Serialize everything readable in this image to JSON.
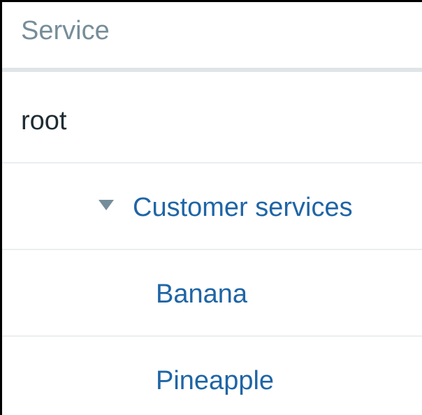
{
  "table": {
    "header": {
      "service_label": "Service"
    },
    "rows": [
      {
        "name": "root",
        "type": "plain",
        "depth": 0
      },
      {
        "name": "Customer services",
        "type": "link",
        "depth": 1,
        "expanded": true,
        "toggle_icon": "triangle-down-icon"
      },
      {
        "name": "Banana",
        "type": "link",
        "depth": 2
      },
      {
        "name": "Pineapple",
        "type": "link",
        "depth": 2
      }
    ]
  },
  "colors": {
    "link": "#1f65a6",
    "header_text": "#768d99",
    "text": "#1f2c33",
    "divider": "#ebeef0",
    "header_divider": "#dfe4e7"
  }
}
